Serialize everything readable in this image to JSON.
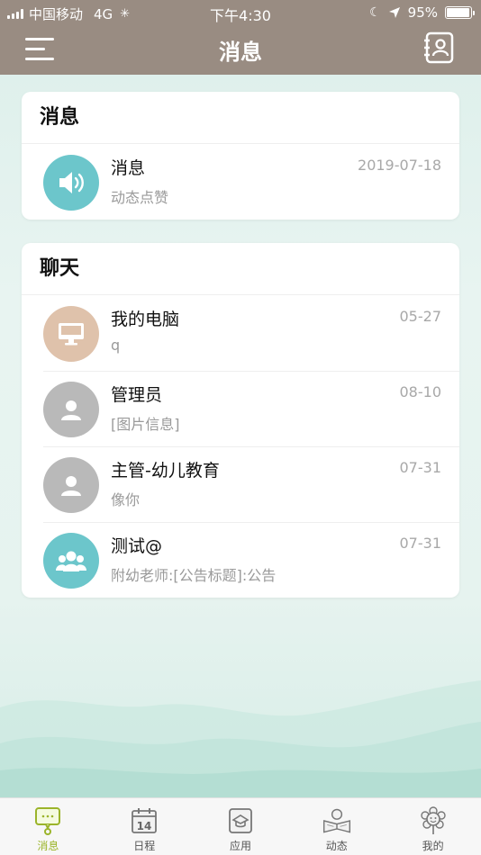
{
  "status_bar": {
    "carrier": "中国移动",
    "network": "4G",
    "time": "下午4:30",
    "battery": "95%",
    "battery_level": 0.95
  },
  "header": {
    "title": "消息",
    "menu_icon": "hamburger-menu-icon",
    "contacts_icon": "contacts-book-icon"
  },
  "notifications": {
    "title": "消息",
    "items": [
      {
        "name": "消息",
        "subtitle": "动态点赞",
        "time": "2019-07-18",
        "icon": "speaker-icon",
        "color": "#6cc6cb"
      }
    ]
  },
  "chats": {
    "title": "聊天",
    "items": [
      {
        "name": "我的电脑",
        "subtitle": "q",
        "time": "05-27",
        "icon": "computer-icon",
        "color": "#dfc2ab"
      },
      {
        "name": "管理员",
        "subtitle": "[图片信息]",
        "time": "08-10",
        "icon": "person-icon",
        "color": "#b9b9b9"
      },
      {
        "name": "主管-幼儿教育",
        "subtitle": "像你",
        "time": "07-31",
        "icon": "person-icon",
        "color": "#b9b9b9"
      },
      {
        "name": "测试@",
        "subtitle": "附幼老师:[公告标题]:公告",
        "time": "07-31",
        "icon": "group-icon",
        "color": "#6cc6cb"
      }
    ]
  },
  "tabbar": {
    "active_color": "#9bb42a",
    "tabs": [
      {
        "label": "消息",
        "icon": "message-bubble-icon",
        "active": true
      },
      {
        "label": "日程",
        "icon": "calendar-icon",
        "calendar_day": "14"
      },
      {
        "label": "应用",
        "icon": "apps-icon"
      },
      {
        "label": "动态",
        "icon": "reading-child-icon"
      },
      {
        "label": "我的",
        "icon": "flower-face-icon"
      }
    ]
  }
}
